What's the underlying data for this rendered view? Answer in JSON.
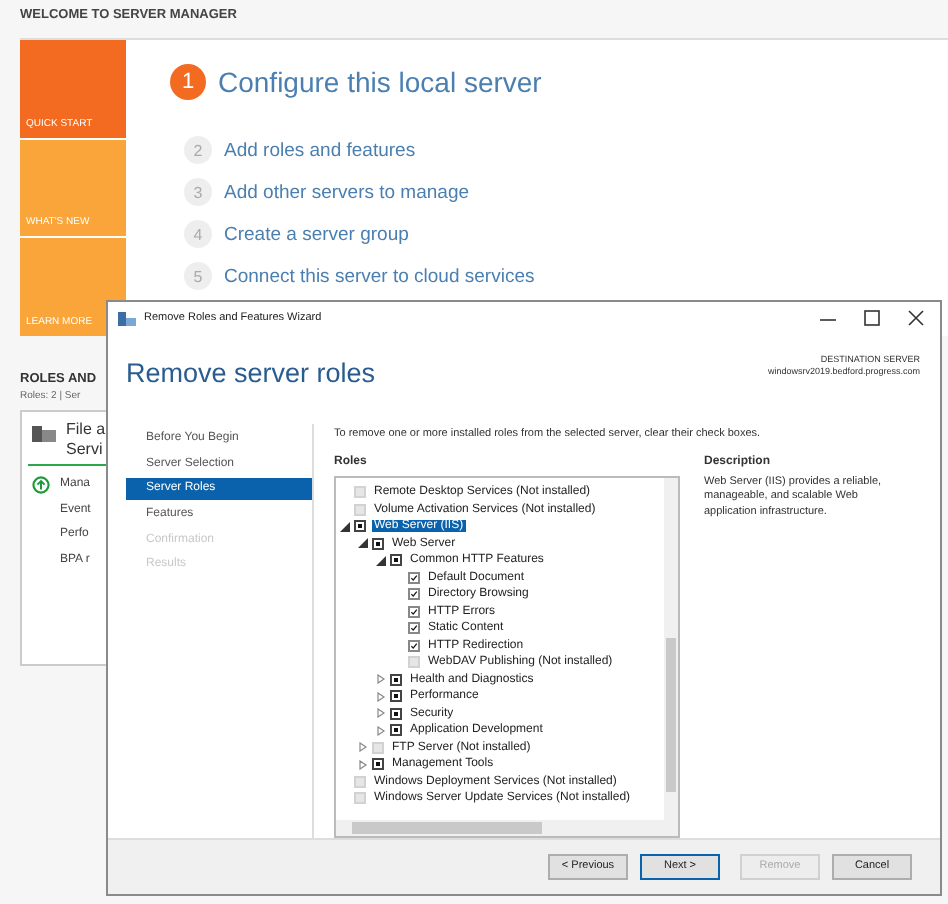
{
  "server_manager": {
    "header": "WELCOME TO SERVER MANAGER",
    "tiles": [
      {
        "label": "QUICK START",
        "selected": true
      },
      {
        "label": "WHAT'S NEW",
        "selected": false
      },
      {
        "label": "LEARN MORE",
        "selected": false
      }
    ],
    "steps": [
      {
        "number": "1",
        "label": "Configure this local server",
        "selected": true
      },
      {
        "number": "2",
        "label": "Add roles and features",
        "selected": false
      },
      {
        "number": "3",
        "label": "Add other servers to manage",
        "selected": false
      },
      {
        "number": "4",
        "label": "Create a server group",
        "selected": false
      },
      {
        "number": "5",
        "label": "Connect this server to cloud services",
        "selected": false
      }
    ],
    "roles_heading": "ROLES AND",
    "roles_summary": "Roles: 2  |  Ser",
    "card": {
      "title_lines": [
        "File a",
        "Servi"
      ],
      "items": [
        "Mana",
        "Event",
        "Perfo",
        "BPA r"
      ]
    }
  },
  "wizard": {
    "title": "Remove Roles and Features Wizard",
    "heading": "Remove server roles",
    "destination_label": "DESTINATION SERVER",
    "destination_server": "windowsrv2019.bedford.progress.com",
    "nav": [
      {
        "label": "Before You Begin",
        "selected": false,
        "disabled": false
      },
      {
        "label": "Server Selection",
        "selected": false,
        "disabled": false
      },
      {
        "label": "Server Roles",
        "selected": true,
        "disabled": false
      },
      {
        "label": "Features",
        "selected": false,
        "disabled": false
      },
      {
        "label": "Confirmation",
        "selected": false,
        "disabled": true
      },
      {
        "label": "Results",
        "selected": false,
        "disabled": true
      }
    ],
    "instruction": "To remove one or more installed roles from the selected server, clear their check boxes.",
    "roles": {
      "label": "Roles",
      "items": [
        {
          "label": "Remote Desktop Services (Not installed)",
          "checked": false,
          "indeterminate": false,
          "selected": false
        },
        {
          "label": "Volume Activation Services (Not installed)",
          "checked": false,
          "indeterminate": false,
          "selected": false
        },
        {
          "label": "Web Server (IIS)",
          "checked": true,
          "indeterminate": true,
          "selected": true,
          "expanded": true,
          "children": [
            {
              "label": "Web Server",
              "checked": true,
              "indeterminate": true,
              "selected": false,
              "expanded": true,
              "children": [
                {
                  "label": "Common HTTP Features",
                  "checked": true,
                  "indeterminate": true,
                  "selected": false,
                  "expanded": true,
                  "children": [
                    {
                      "label": "Default Document",
                      "checked": true,
                      "indeterminate": false,
                      "selected": false
                    },
                    {
                      "label": "Directory Browsing",
                      "checked": true,
                      "indeterminate": false,
                      "selected": false
                    },
                    {
                      "label": "HTTP Errors",
                      "checked": true,
                      "indeterminate": false,
                      "selected": false
                    },
                    {
                      "label": "Static Content",
                      "checked": true,
                      "indeterminate": false,
                      "selected": false
                    },
                    {
                      "label": "HTTP Redirection",
                      "checked": true,
                      "indeterminate": false,
                      "selected": false
                    },
                    {
                      "label": "WebDAV Publishing (Not installed)",
                      "checked": false,
                      "indeterminate": false,
                      "selected": false
                    }
                  ]
                },
                {
                  "label": "Health and Diagnostics",
                  "checked": true,
                  "indeterminate": true,
                  "selected": false,
                  "expanded": false
                },
                {
                  "label": "Performance",
                  "checked": true,
                  "indeterminate": true,
                  "selected": false,
                  "expanded": false
                },
                {
                  "label": "Security",
                  "checked": true,
                  "indeterminate": true,
                  "selected": false,
                  "expanded": false
                },
                {
                  "label": "Application Development",
                  "checked": true,
                  "indeterminate": true,
                  "selected": false,
                  "expanded": false
                }
              ]
            },
            {
              "label": "FTP Server (Not installed)",
              "checked": false,
              "indeterminate": false,
              "selected": false,
              "expanded": false
            },
            {
              "label": "Management Tools",
              "checked": true,
              "indeterminate": true,
              "selected": false,
              "expanded": false
            }
          ]
        },
        {
          "label": "Windows Deployment Services (Not installed)",
          "checked": false,
          "indeterminate": false,
          "selected": false
        },
        {
          "label": "Windows Server Update Services (Not installed)",
          "checked": false,
          "indeterminate": false,
          "selected": false
        }
      ]
    },
    "description": {
      "label": "Description",
      "text": "Web Server (IIS) provides a reliable, manageable, and scalable Web application infrastructure."
    },
    "buttons": [
      {
        "label": "< Previous",
        "disabled": false,
        "selected": false
      },
      {
        "label": "Next >",
        "disabled": false,
        "selected": true
      },
      {
        "label": "Remove",
        "disabled": true,
        "selected": false
      },
      {
        "label": "Cancel",
        "disabled": false,
        "selected": false
      }
    ]
  }
}
